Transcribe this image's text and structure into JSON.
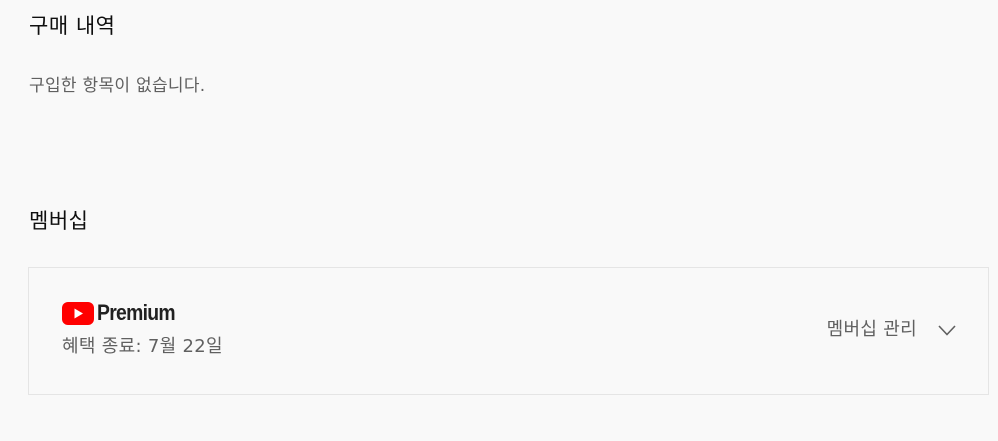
{
  "purchases": {
    "title": "구매 내역",
    "empty_message": "구입한 항목이 없습니다."
  },
  "membership": {
    "title": "멤버십",
    "card": {
      "logo_icon": "youtube-play-icon",
      "logo_text": "Premium",
      "benefit_text": "혜택 종료: 7월 22일",
      "manage_label": "멤버십 관리",
      "expand_icon": "chevron-down-icon"
    }
  },
  "colors": {
    "background": "#f9f9f9",
    "brand_red": "#ff0000",
    "secondary_text": "#606060",
    "border": "#e5e5e5"
  }
}
